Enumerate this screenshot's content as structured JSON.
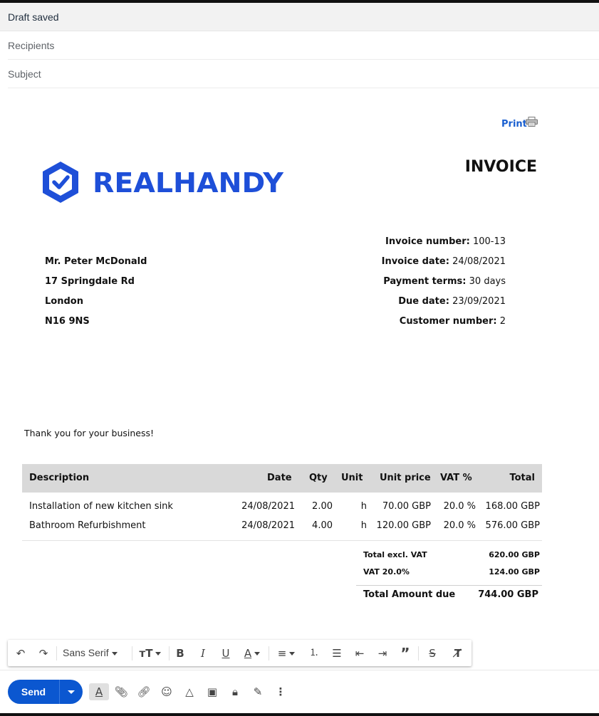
{
  "compose": {
    "status": "Draft saved",
    "recipients_placeholder": "Recipients",
    "subject_placeholder": "Subject"
  },
  "invoice": {
    "print_label": "Print",
    "title": "INVOICE",
    "logo_text": "REALHANDY",
    "customer": {
      "name": "Mr. Peter McDonald",
      "street": "17 Springdale Rd",
      "city": "London",
      "postcode": "N16 9NS"
    },
    "meta": [
      {
        "label": "Invoice number:",
        "value": "100-13"
      },
      {
        "label": "Invoice date:",
        "value": "24/08/2021"
      },
      {
        "label": "Payment terms:",
        "value": "30 days"
      },
      {
        "label": "Due date:",
        "value": "23/09/2021"
      },
      {
        "label": "Customer number:",
        "value": "2"
      }
    ],
    "thanks": "Thank you for your business!",
    "columns": [
      "Description",
      "Date",
      "Qty",
      "Unit",
      "Unit price",
      "VAT %",
      "Total"
    ],
    "rows": [
      [
        "Installation of new kitchen sink",
        "24/08/2021",
        "2.00",
        "h",
        "70.00 GBP",
        "20.0 %",
        "168.00 GBP"
      ],
      [
        "Bathroom Refurbishment",
        "24/08/2021",
        "4.00",
        "h",
        "120.00 GBP",
        "20.0 %",
        "576.00 GBP"
      ]
    ],
    "totals": {
      "excl_label": "Total excl. VAT",
      "excl_value": "620.00 GBP",
      "vat_label": "VAT 20.0%",
      "vat_value": "124.00 GBP",
      "due_label": "Total Amount due",
      "due_value": "744.00 GBP"
    }
  },
  "toolbar": {
    "font": "Sans Serif",
    "icons": [
      "undo-icon",
      "redo-icon",
      "font-size-icon",
      "bold-icon",
      "italic-icon",
      "underline-icon",
      "text-color-icon",
      "align-icon",
      "numbered-list-icon",
      "bulleted-list-icon",
      "indent-less-icon",
      "indent-more-icon",
      "quote-icon",
      "strikethrough-icon",
      "remove-formatting-icon"
    ]
  },
  "actions": {
    "send_label": "Send",
    "icons": [
      "formatting-options-icon",
      "attach-icon",
      "link-icon",
      "emoji-icon",
      "drive-icon",
      "photo-icon",
      "confidential-icon",
      "signature-icon",
      "more-options-icon"
    ]
  },
  "colors": {
    "send": "#0b57d0",
    "logo": "#1e4fd8",
    "link": "#1a5fd0",
    "table_header": "#d9d9d9"
  }
}
